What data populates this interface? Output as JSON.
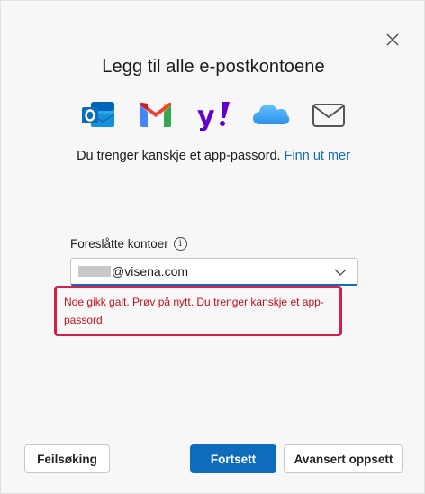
{
  "dialog": {
    "title": "Legg til alle e-postkontoene",
    "close_icon": "close-icon"
  },
  "providers": [
    {
      "name": "Outlook",
      "icon": "outlook-icon",
      "color": "#0f6cbd"
    },
    {
      "name": "Gmail",
      "icon": "gmail-icon",
      "color": "#ea4335"
    },
    {
      "name": "Yahoo",
      "icon": "yahoo-icon",
      "color": "#6001d2"
    },
    {
      "name": "iCloud",
      "icon": "icloud-icon",
      "color": "#3aa0f0"
    },
    {
      "name": "Other email",
      "icon": "mail-envelope-icon",
      "color": "#555555"
    }
  ],
  "hint": {
    "text": "Du trenger kanskje et app-passord.",
    "link": "Finn ut mer"
  },
  "accounts": {
    "label": "Foreslåtte kontoer",
    "selected_value": "@visena.com",
    "info_icon": "i"
  },
  "error": {
    "message": "Noe gikk galt. Prøv på nytt. Du trenger kanskje et app-passord."
  },
  "buttons": {
    "troubleshoot": "Feilsøking",
    "continue": "Fortsett",
    "advanced": "Avansert oppsett"
  },
  "colors": {
    "accent": "#0f6cbd",
    "error": "#c50f1f",
    "error_border": "#d4204a"
  }
}
